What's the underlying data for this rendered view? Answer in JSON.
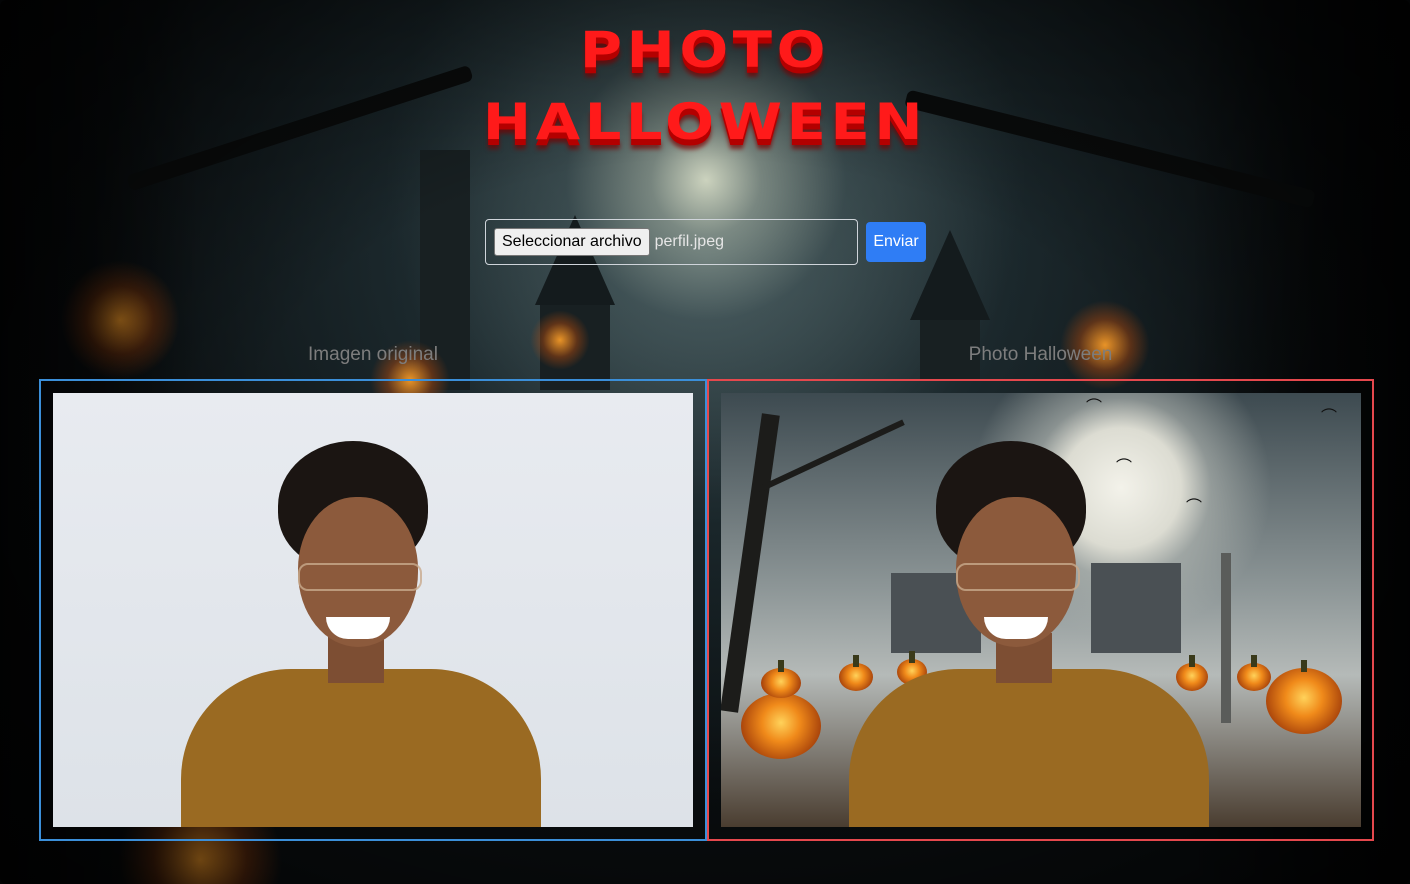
{
  "title": {
    "line1": "PHOTO",
    "line2": "HALLOWEEN"
  },
  "form": {
    "file_button_label": "Seleccionar archivo",
    "file_name": "perfil.jpeg",
    "submit_label": "Enviar"
  },
  "panels": {
    "original_label": "Imagen original",
    "halloween_label": "Photo Halloween"
  },
  "colors": {
    "title": "#ff1a1a",
    "submit": "#2f7df5",
    "original_border": "#3b8fd9",
    "halloween_border": "#e5484d"
  }
}
